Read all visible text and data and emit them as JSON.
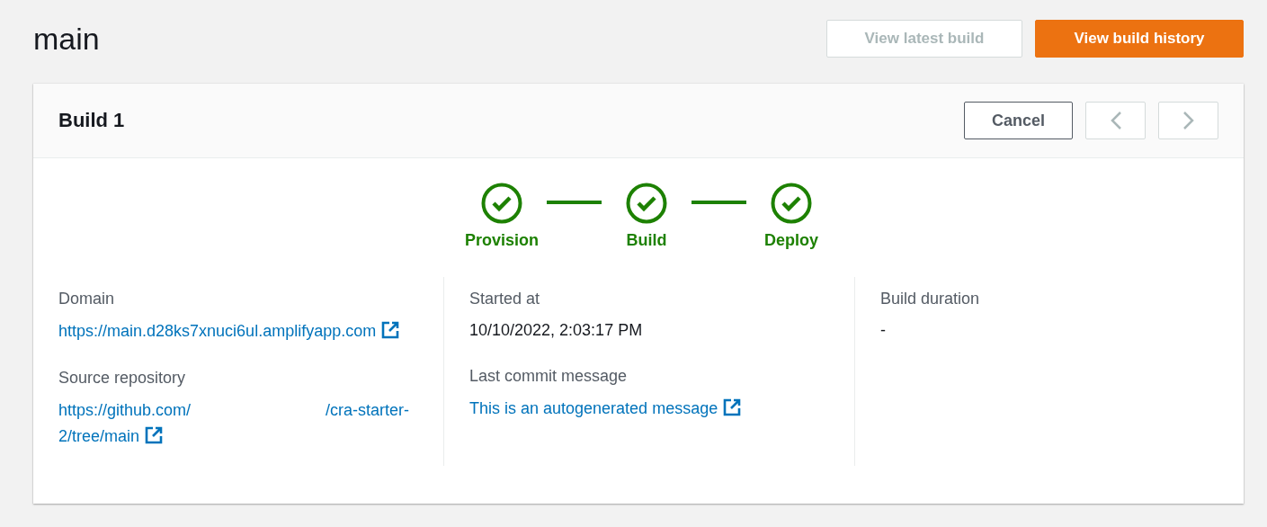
{
  "page": {
    "title": "main"
  },
  "header_buttons": [
    {
      "label": "View latest build",
      "kind": "secondary",
      "disabled": true
    },
    {
      "label": "View build history",
      "kind": "primary",
      "disabled": false
    }
  ],
  "build": {
    "title": "Build 1",
    "cancel_label": "Cancel",
    "prev_disabled": true,
    "next_disabled": true,
    "steps": [
      {
        "label": "Provision",
        "done": true
      },
      {
        "label": "Build",
        "done": true
      },
      {
        "label": "Deploy",
        "done": true
      }
    ],
    "columns": [
      {
        "fields": [
          {
            "label": "Domain",
            "kind": "link",
            "parts": [
              "https://main.d28ks7xnuci6ul.amplifyapp.com"
            ]
          },
          {
            "label": "Source repository",
            "kind": "link",
            "parts": [
              "https://github.com/",
              "/cra-starter-2/tree/main"
            ]
          }
        ]
      },
      {
        "fields": [
          {
            "label": "Started at",
            "kind": "text",
            "parts": [
              "10/10/2022, 2:03:17 PM"
            ]
          },
          {
            "label": "Last commit message",
            "kind": "link",
            "parts": [
              "This is an autogenerated message"
            ]
          }
        ]
      },
      {
        "fields": [
          {
            "label": "Build duration",
            "kind": "text",
            "parts": [
              "-"
            ]
          }
        ]
      }
    ]
  }
}
